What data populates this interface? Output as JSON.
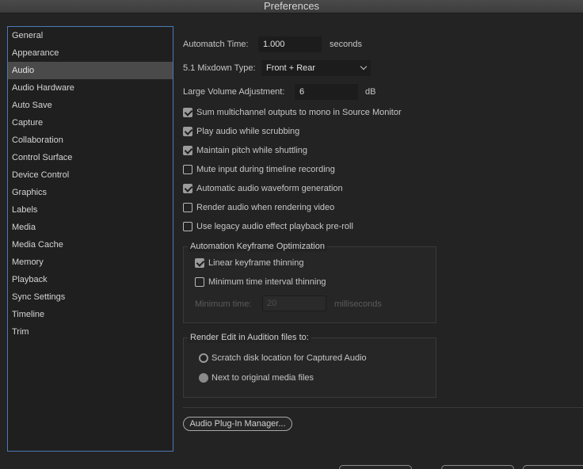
{
  "window": {
    "title": "Preferences"
  },
  "sidebar": {
    "items": [
      {
        "label": "General"
      },
      {
        "label": "Appearance"
      },
      {
        "label": "Audio",
        "selected": true
      },
      {
        "label": "Audio Hardware"
      },
      {
        "label": "Auto Save"
      },
      {
        "label": "Capture"
      },
      {
        "label": "Collaboration"
      },
      {
        "label": "Control Surface"
      },
      {
        "label": "Device Control"
      },
      {
        "label": "Graphics"
      },
      {
        "label": "Labels"
      },
      {
        "label": "Media"
      },
      {
        "label": "Media Cache"
      },
      {
        "label": "Memory"
      },
      {
        "label": "Playback"
      },
      {
        "label": "Sync Settings"
      },
      {
        "label": "Timeline"
      },
      {
        "label": "Trim"
      }
    ]
  },
  "audio": {
    "automatch_label": "Automatch Time:",
    "automatch_value": "1.000",
    "automatch_unit": "seconds",
    "mixdown_label": "5.1 Mixdown Type:",
    "mixdown_value": "Front + Rear",
    "volume_label": "Large Volume Adjustment:",
    "volume_value": "6",
    "volume_unit": "dB",
    "options": [
      {
        "label": "Sum multichannel outputs to mono in Source Monitor",
        "checked": true
      },
      {
        "label": "Play audio while scrubbing",
        "checked": true
      },
      {
        "label": "Maintain pitch while shuttling",
        "checked": true
      },
      {
        "label": "Mute input during timeline recording",
        "checked": false
      },
      {
        "label": "Automatic audio waveform generation",
        "checked": true
      },
      {
        "label": "Render audio when rendering video",
        "checked": false
      },
      {
        "label": "Use legacy audio effect playback pre-roll",
        "checked": false
      }
    ]
  },
  "keyframe_group": {
    "title": "Automation Keyframe Optimization",
    "linear_label": "Linear keyframe thinning",
    "linear_checked": true,
    "min_interval_label": "Minimum time interval thinning",
    "min_interval_checked": false,
    "min_time_label": "Minimum time:",
    "min_time_value": "20",
    "min_time_unit": "milliseconds"
  },
  "audition_group": {
    "title": "Render Edit in Audition files to:",
    "option_scratch": "Scratch disk location for Captured Audio",
    "option_next": "Next to original media files",
    "selected": "next"
  },
  "buttons": {
    "plugin_manager": "Audio Plug-In Manager..."
  }
}
